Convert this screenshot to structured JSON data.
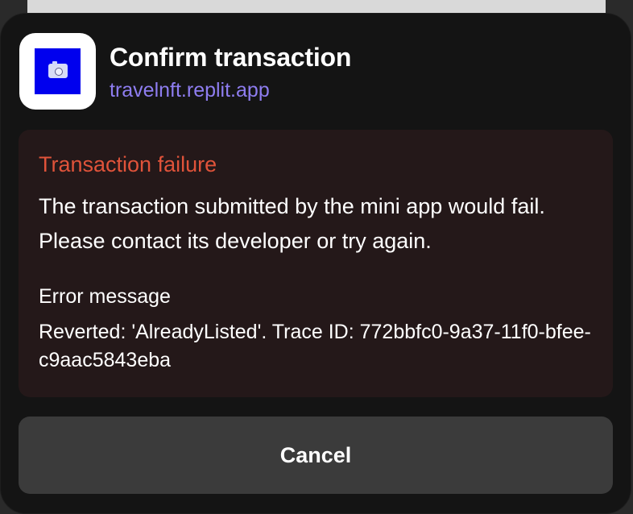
{
  "app": {
    "title": "Confirm transaction",
    "domain": "travelnft.replit.app"
  },
  "error": {
    "title": "Transaction failure",
    "description": "The transaction submitted by the mini app would fail. Please contact its developer or try again.",
    "label": "Error message",
    "message": "Reverted: 'AlreadyListed'. Trace ID: 772bbfc0-9a37-11f0-bfee-c9aac5843eba"
  },
  "actions": {
    "cancel_label": "Cancel"
  },
  "colors": {
    "modal_bg": "#141414",
    "error_bg": "#241819",
    "error_accent": "#e0533a",
    "link_accent": "#8e7df0",
    "app_icon_bg": "#0000ee",
    "button_bg": "#3b3b3b"
  },
  "icons": {
    "app_icon": "camera-icon"
  }
}
